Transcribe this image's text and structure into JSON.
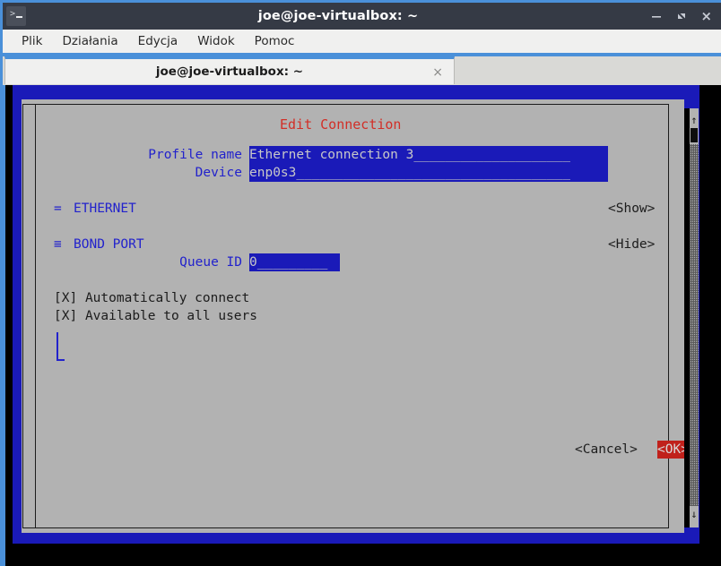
{
  "window": {
    "title": "joe@joe-virtualbox: ~",
    "icon": "terminal-icon",
    "buttons": {
      "minimize": "minimize-icon",
      "maximize": "maximize-icon",
      "close": "close-icon"
    }
  },
  "menubar": {
    "items": [
      {
        "label": "Plik"
      },
      {
        "label": "Działania"
      },
      {
        "label": "Edycja"
      },
      {
        "label": "Widok"
      },
      {
        "label": "Pomoc"
      }
    ]
  },
  "tabs": [
    {
      "label": "joe@joe-virtualbox: ~",
      "close": "×",
      "active": true
    }
  ],
  "dialog": {
    "title": "Edit Connection",
    "title_color": "#d22f27",
    "fields": [
      {
        "label": "Profile name",
        "value": "Ethernet connection 3",
        "filler": "____________________"
      },
      {
        "label": "Device",
        "value": "enp0s3",
        "filler": "___________________________________"
      }
    ],
    "sections": [
      {
        "marker": "=",
        "label": "ETHERNET",
        "action": "<Show>",
        "expanded": false
      },
      {
        "marker": "≡",
        "label": "BOND PORT",
        "action": "<Hide>",
        "expanded": true
      }
    ],
    "bond_fields": [
      {
        "label": "Queue ID",
        "value": "0",
        "filler": "_________"
      }
    ],
    "checkboxes": [
      {
        "mark": "[X]",
        "label": "Automatically connect",
        "checked": true
      },
      {
        "mark": "[X]",
        "label": "Available to all users",
        "checked": true
      }
    ],
    "buttons": {
      "cancel": "<Cancel>",
      "ok": "<OK>",
      "ok_bg": "#c0211b"
    },
    "scrollbar": {
      "up_arrow": "↑",
      "down_arrow": "↓"
    }
  },
  "colors": {
    "titlebar": "#353a45",
    "tab_accent": "#4a90d9",
    "nm_blue": "#1a1ab8",
    "dialog_gray": "#b2b2b2",
    "field_blue": "#1a1ab8",
    "label_blue": "#2222cc",
    "terminal_black": "#000000"
  }
}
